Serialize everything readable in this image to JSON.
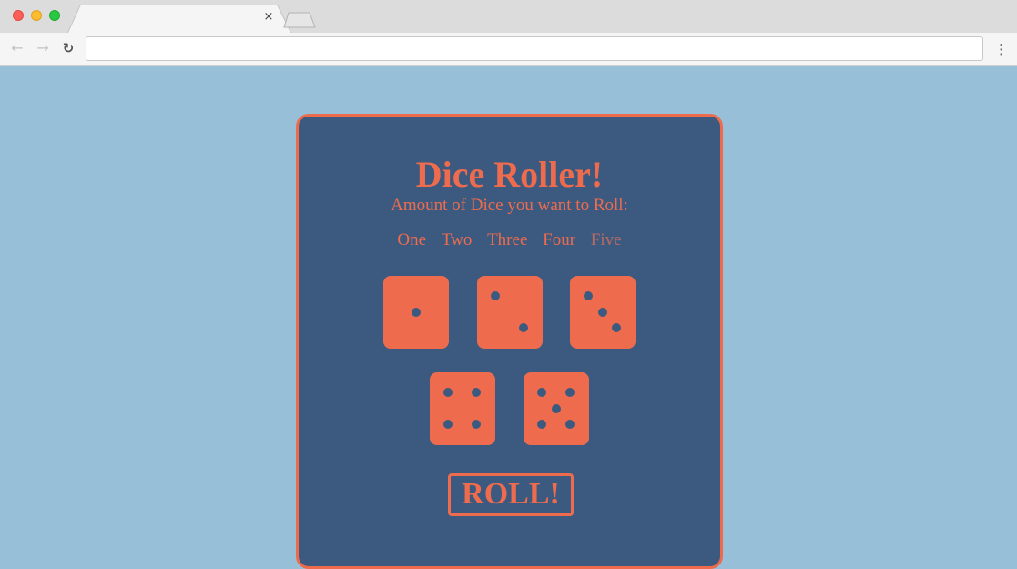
{
  "browser": {
    "tab_close": "×",
    "back_icon": "arrow-left-icon",
    "forward_icon": "arrow-right-icon",
    "reload_icon": "reload-icon",
    "menu_icon": "kebab-menu-icon",
    "address": ""
  },
  "app": {
    "title": "Dice Roller!",
    "subtitle": "Amount of Dice you want to Roll:",
    "count_options": [
      "One",
      "Two",
      "Three",
      "Four",
      "Five"
    ],
    "selected_count": "Five",
    "dice_values": [
      1,
      2,
      3,
      4,
      5
    ],
    "roll_label": "ROLL!"
  },
  "colors": {
    "page_background": "#97bfd8",
    "card_background": "#3c5a80",
    "accent": "#ee6c4d",
    "selected_option": "#b96a63"
  }
}
